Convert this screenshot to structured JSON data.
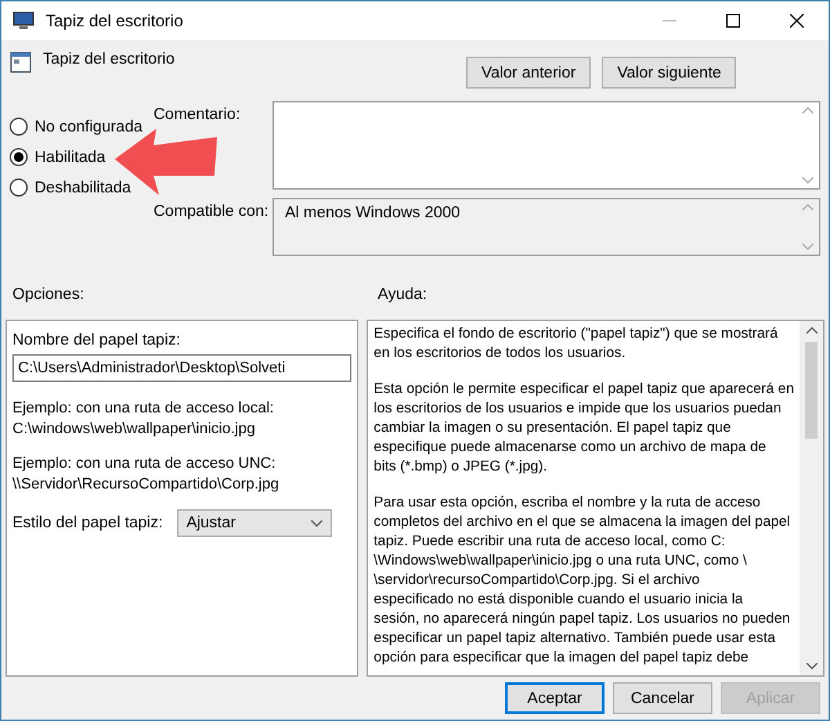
{
  "window": {
    "title": "Tapiz del escritorio"
  },
  "policy": {
    "title": "Tapiz del escritorio"
  },
  "nav_buttons": [
    {
      "label": "Valor anterior"
    },
    {
      "label": "Valor siguiente"
    }
  ],
  "states": [
    {
      "label": "No configurada",
      "selected": false
    },
    {
      "label": "Habilitada",
      "selected": true
    },
    {
      "label": "Deshabilitada",
      "selected": false
    }
  ],
  "comment": {
    "label": "Comentario:"
  },
  "compatible": {
    "label": "Compatible con:",
    "value": "Al menos Windows 2000"
  },
  "options": {
    "heading": "Opciones:",
    "name_label": "Nombre del papel tapiz:",
    "name_value": "C:\\Users\\Administrador\\Desktop\\Solveti",
    "examples": [
      [
        "Ejemplo: con una ruta de acceso local:",
        "C:\\windows\\web\\wallpaper\\inicio.jpg"
      ],
      [
        "Ejemplo: con una ruta de acceso UNC:",
        "\\\\Servidor\\RecursoCompartido\\Corp.jpg"
      ]
    ],
    "style_label": "Estilo del papel tapiz:",
    "style_value": "Ajustar"
  },
  "help": {
    "heading": "Ayuda:",
    "paragraphs": [
      [
        "Especifica el fondo de escritorio (\"papel tapiz\") que se mostrará",
        "en los escritorios de todos los usuarios."
      ],
      [
        "Esta opción le permite especificar el papel tapiz que aparecerá en",
        "los escritorios de los usuarios e impide que los usuarios puedan",
        "cambiar la imagen o su presentación. El papel tapiz que",
        "especifique puede almacenarse como un archivo de mapa de",
        "bits (*.bmp) o JPEG (*.jpg)."
      ],
      [
        "Para usar esta opción, escriba el nombre y la ruta de acceso",
        "completos del archivo en el que se almacena la imagen del papel",
        "tapiz. Puede escribir una ruta de acceso local, como C:",
        "\\Windows\\web\\wallpaper\\inicio.jpg o una ruta UNC, como \\",
        "\\servidor\\recursoCompartido\\Corp.jpg. Si el archivo",
        "especificado no está disponible cuando el usuario inicia la",
        "sesión, no aparecerá ningún papel tapiz. Los usuarios no pueden",
        "especificar un papel tapiz alternativo. También puede usar esta",
        "opción para especificar que la imagen del papel tapiz debe"
      ]
    ]
  },
  "buttons": [
    {
      "label": "Aceptar",
      "kind": "default",
      "disabled": false
    },
    {
      "label": "Cancelar",
      "kind": "normal",
      "disabled": false
    },
    {
      "label": "Aplicar",
      "kind": "normal",
      "disabled": true
    }
  ]
}
